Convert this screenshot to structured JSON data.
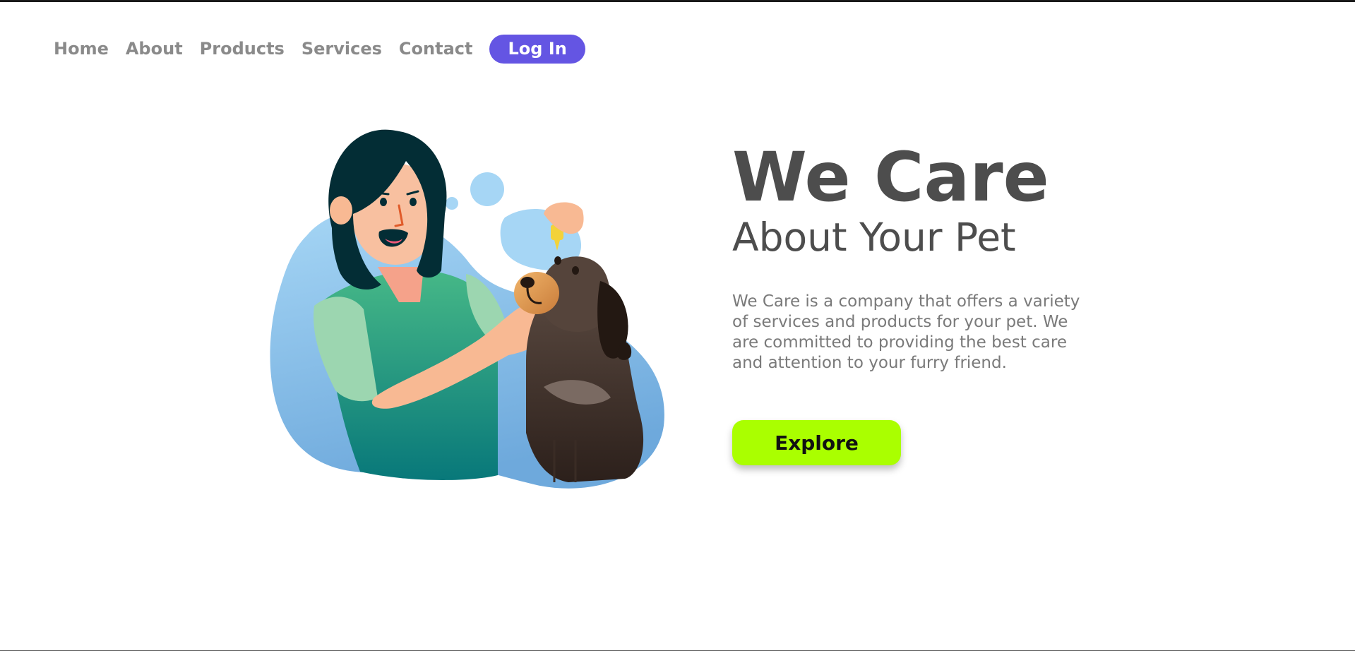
{
  "nav": {
    "items": [
      {
        "label": "Home"
      },
      {
        "label": "About"
      },
      {
        "label": "Products"
      },
      {
        "label": "Services"
      },
      {
        "label": "Contact"
      }
    ],
    "login_label": "Log In"
  },
  "hero": {
    "title": "We Care",
    "subtitle": "About Your Pet",
    "description": "We Care is a company that offers a variety of services and products for your pet. We are committed to providing the best care and attention to your furry friend.",
    "cta_label": "Explore"
  },
  "illustration": {
    "subject": "woman giving eye drops to dog",
    "colors": {
      "blob": "#8fc8ee",
      "hair": "#032d35",
      "shirt": "#3fae82",
      "skin": "#f6b38e",
      "dog": "#4a3a33",
      "dog_muzzle": "#e09a50"
    }
  },
  "colors": {
    "accent": "#6455e3",
    "cta": "#aaff00",
    "heading": "#4d4d4d",
    "nav_text": "#8a8a8a"
  }
}
